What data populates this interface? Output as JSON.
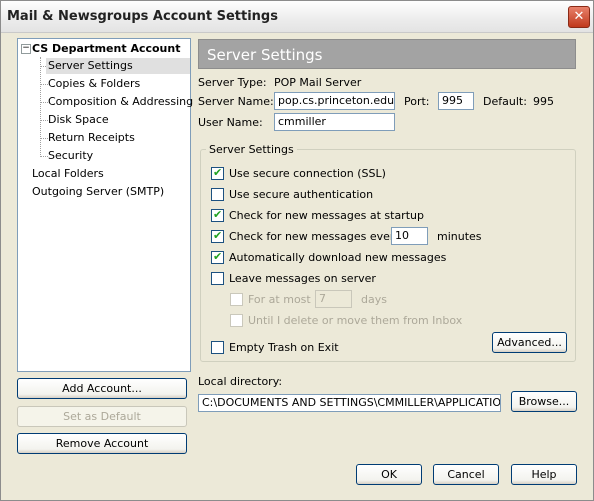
{
  "window": {
    "title": "Mail & Newsgroups Account Settings",
    "close_glyph": "✕"
  },
  "tree": {
    "root": {
      "label": "CS Department Account",
      "expander": "−"
    },
    "children": [
      {
        "label": "Server Settings"
      },
      {
        "label": "Copies & Folders"
      },
      {
        "label": "Composition & Addressing"
      },
      {
        "label": "Disk Space"
      },
      {
        "label": "Return Receipts"
      },
      {
        "label": "Security"
      }
    ],
    "local_folders": "Local Folders",
    "outgoing_server": "Outgoing Server (SMTP)"
  },
  "left_buttons": {
    "add_account": "Add Account...",
    "set_default": "Set as Default",
    "remove_account": "Remove Account"
  },
  "panel": {
    "title": "Server Settings",
    "server_type_label": "Server Type:",
    "server_type_value": "POP Mail Server",
    "server_name_label": "Server Name:",
    "server_name_value": "pop.cs.princeton.edu",
    "port_label": "Port:",
    "port_value": "995",
    "default_label": "Default:",
    "default_value": "995",
    "user_name_label": "User Name:",
    "user_name_value": "cmmiller",
    "group_title": "Server Settings",
    "options": {
      "ssl": {
        "label": "Use secure connection (SSL)",
        "checked": true
      },
      "secure_auth": {
        "label": "Use secure authentication",
        "checked": false
      },
      "check_startup": {
        "label": "Check for new messages at startup",
        "checked": true
      },
      "check_every": {
        "label": "Check for new messages every",
        "checked": true,
        "value": "10",
        "suffix": "minutes"
      },
      "auto_download": {
        "label": "Automatically download new messages",
        "checked": true
      },
      "leave_on_server": {
        "label": "Leave messages on server",
        "checked": false
      },
      "for_at_most": {
        "label": "For at most",
        "value": "7",
        "suffix": "days",
        "checked": false
      },
      "until_delete": {
        "label": "Until I delete or move them from Inbox",
        "checked": false
      },
      "empty_trash": {
        "label": "Empty Trash on Exit",
        "checked": false
      }
    },
    "advanced_button": "Advanced...",
    "local_directory_label": "Local directory:",
    "local_directory_value": "C:\\DOCUMENTS AND SETTINGS\\CMMILLER\\APPLICATION DAT",
    "browse_button": "Browse..."
  },
  "footer": {
    "ok": "OK",
    "cancel": "Cancel",
    "help": "Help"
  },
  "check_glyph": "✔"
}
